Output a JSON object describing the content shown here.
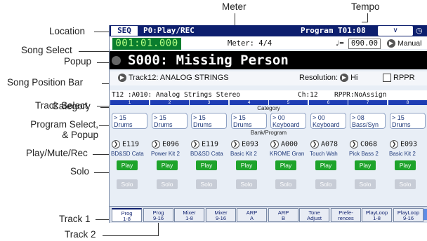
{
  "callouts": {
    "meter": "Meter",
    "tempo": "Tempo",
    "location": "Location",
    "song_select": "Song Select",
    "popup": "Popup",
    "song_position_bar": "Song Position Bar",
    "track_select": "Track Select",
    "category": "Category",
    "program_select_1": "Program Select,",
    "program_select_2": "& Popup",
    "play_mute_rec": "Play/Mute/Rec",
    "solo": "Solo",
    "track1": "Track 1",
    "track2": "Track 2"
  },
  "titlebar": {
    "mode": "SEQ",
    "page": "P0:Play/REC",
    "program": "Program T01:08",
    "menu_icon": "chevron-down-icon"
  },
  "location": "001:01.000",
  "meter": "Meter: 4/4",
  "tempo": {
    "symbol": "♩=",
    "value": "090.00",
    "mode": "Manual"
  },
  "song": {
    "name": "S000: Missing Person"
  },
  "track_select": "Track12: ANALOG STRINGS",
  "resolution": {
    "label": "Resolution:",
    "value": "Hi"
  },
  "rppr_checkbox": "RPPR",
  "info_bar": {
    "track": "T12 :A010: Analog Strings Stereo",
    "channel": "Ch:12",
    "rppr": "RPPR:NoAssign"
  },
  "section_labels": {
    "category": "Category",
    "bank_program": "Bank/Program"
  },
  "tracks": [
    {
      "num": "1",
      "cat_id": "> 15",
      "cat_name": "Drums",
      "prog": "E119",
      "prog_name": "BD&SD Cata",
      "play": "Play",
      "solo": "Solo"
    },
    {
      "num": "2",
      "cat_id": "> 15",
      "cat_name": "Drums",
      "prog": "E096",
      "prog_name": "Power Kit 2",
      "play": "Play",
      "solo": "Solo"
    },
    {
      "num": "3",
      "cat_id": "> 15",
      "cat_name": "Drums",
      "prog": "E119",
      "prog_name": "BD&SD Cata",
      "play": "Play",
      "solo": "Solo"
    },
    {
      "num": "4",
      "cat_id": "> 15",
      "cat_name": "Drums",
      "prog": "E093",
      "prog_name": "Basic Kit 2",
      "play": "Play",
      "solo": "Solo"
    },
    {
      "num": "5",
      "cat_id": "> 00",
      "cat_name": "Keyboard",
      "prog": "A000",
      "prog_name": "KROME Gran",
      "play": "Play",
      "solo": "Solo"
    },
    {
      "num": "6",
      "cat_id": "> 00",
      "cat_name": "Keyboard",
      "prog": "A078",
      "prog_name": "Touch Wah",
      "play": "Play",
      "solo": "Solo"
    },
    {
      "num": "7",
      "cat_id": "> 08",
      "cat_name": "Bass/Syn",
      "prog": "C068",
      "prog_name": "Pick Bass 2",
      "play": "Play",
      "solo": "Solo"
    },
    {
      "num": "8",
      "cat_id": "> 15",
      "cat_name": "Drums",
      "prog": "E093",
      "prog_name": "Basic Kit 2",
      "play": "Play",
      "solo": "Solo"
    }
  ],
  "tabs": [
    {
      "l1": "Prog",
      "l2": "1-8"
    },
    {
      "l1": "Prog",
      "l2": "9-16"
    },
    {
      "l1": "Mixer",
      "l2": "1-8"
    },
    {
      "l1": "Mixer",
      "l2": "9-16"
    },
    {
      "l1": "ARP",
      "l2": "A"
    },
    {
      "l1": "ARP",
      "l2": "B"
    },
    {
      "l1": "Tone",
      "l2": "Adjust"
    },
    {
      "l1": "Prefe-",
      "l2": "rences"
    },
    {
      "l1": "PlayLoop",
      "l2": "1-8"
    },
    {
      "l1": "PlayLoop",
      "l2": "9-16"
    }
  ],
  "colors": {
    "title_bar": "#0d1f6e",
    "location_bg": "#0a7d2e",
    "location_text": "#b6ff84",
    "play_green": "#1ea32b",
    "track_header": "#1e3db4"
  }
}
